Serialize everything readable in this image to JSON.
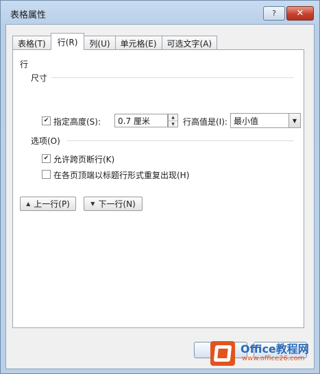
{
  "window": {
    "title": "表格属性",
    "help_label": "?",
    "close_label": "✕"
  },
  "tabs": [
    {
      "label": "表格(T)",
      "active": false
    },
    {
      "label": "行(R)",
      "active": true
    },
    {
      "label": "列(U)",
      "active": false
    },
    {
      "label": "单元格(E)",
      "active": false
    },
    {
      "label": "可选文字(A)",
      "active": false
    }
  ],
  "row_panel": {
    "heading": "行",
    "size_group": "尺寸",
    "specify_height": {
      "label": "指定高度(S):",
      "checked": true
    },
    "height_value": "0.7 厘米",
    "row_height_label": "行高值是(I):",
    "row_height_mode": "最小值",
    "options_group": "选项(O)",
    "allow_break": {
      "label": "允许跨页断行(K)",
      "checked": true
    },
    "repeat_header": {
      "label": "在各页顶端以标题行形式重复出现(H)",
      "checked": false
    },
    "prev_row": "上一行(P)",
    "next_row": "下一行(N)"
  },
  "watermark": {
    "brand_latin": "Office",
    "brand_cn": "教程网",
    "url": "www.office26.com",
    "color": "#e2541e"
  },
  "icons": {
    "spin_up": "▲",
    "spin_down": "▼",
    "dropdown": "▼",
    "check": "✔",
    "arrow_up": "▲",
    "arrow_down": "▼"
  }
}
